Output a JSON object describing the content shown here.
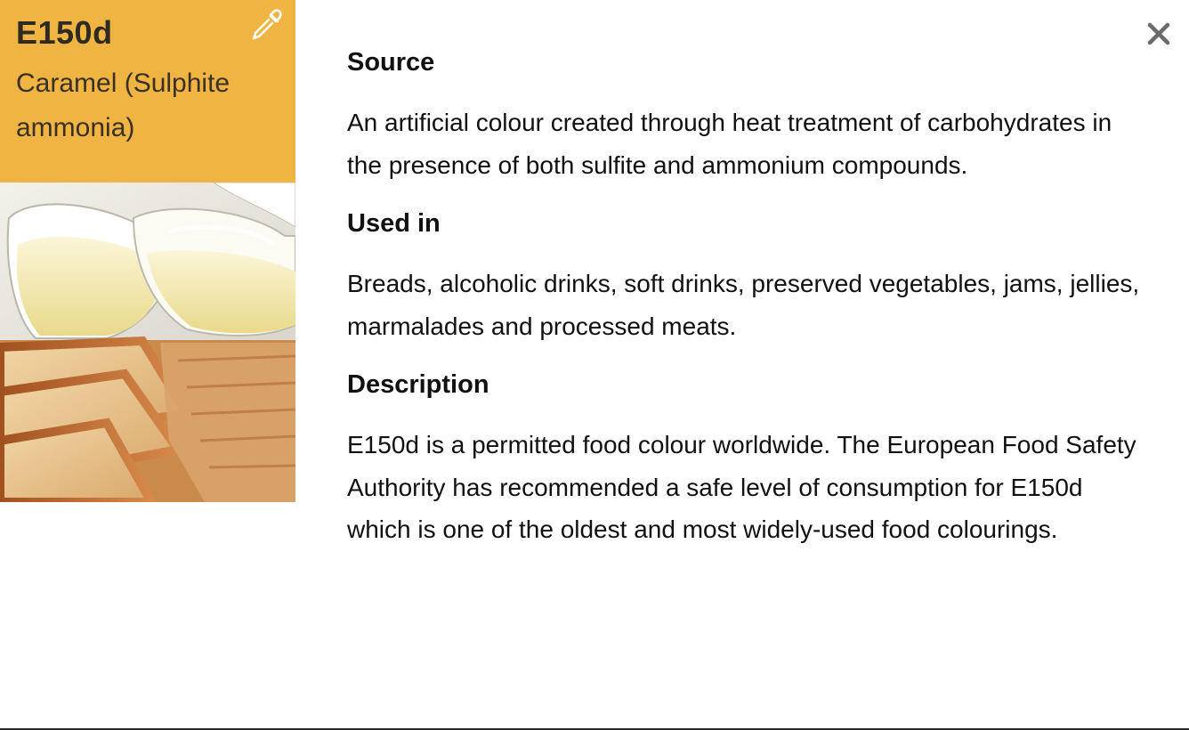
{
  "additive": {
    "code": "E150d",
    "name": "Caramel (Sulphite ammonia)",
    "category_icon": "eyedropper-icon",
    "accent_color": "#efb441",
    "image_description": "wine-glasses-and-sliced-bread"
  },
  "details": {
    "source_heading": "Source",
    "source_text": "An artificial colour created through heat treatment of carbohydrates in the presence of both sulfite and ammonium compounds.",
    "used_in_heading": "Used in",
    "used_in_text": "Breads, alcoholic drinks, soft drinks, preserved vegetables, jams, jellies, marmalades and processed meats.",
    "description_heading": "Description",
    "description_text": "E150d is a permitted food colour worldwide. The European Food Safety Authority has recommended a safe level of consumption for E150d which is one of the oldest and most widely-used food colourings."
  },
  "controls": {
    "close_icon": "close-icon"
  }
}
